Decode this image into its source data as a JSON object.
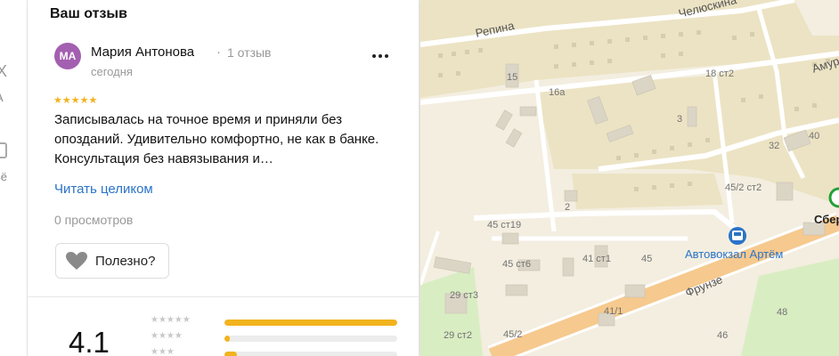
{
  "sidebar_fragment": {
    "glyph_top": "X",
    "glyph_mid": "А",
    "glyph_bottom": "ьё"
  },
  "review": {
    "section_title": "Ваш отзыв",
    "author": {
      "initials": "МА",
      "name": "Мария Антонова",
      "separator": "·",
      "review_count": "1 отзыв",
      "avatar_color": "#a35fb0"
    },
    "date": "сегодня",
    "stars": "★★★★★",
    "rating": 5,
    "text": "Записывалась на точное время и приняли без опозданий. Удивительно комфортно, не как в банке. Консультация без навязывания и…",
    "read_more_label": "Читать целиком",
    "views": "0 просмотров",
    "helpful_label": "Полезно?",
    "more_icon": "more-dots-icon"
  },
  "rating_summary": {
    "value": "4.1",
    "rows": [
      {
        "stars": "★★★★★",
        "share": 1.0
      },
      {
        "stars": "★★★★",
        "share": 0.03
      },
      {
        "stars": "★★★",
        "share": 0.07
      }
    ],
    "accent_color": "#f2b31d"
  },
  "map": {
    "streets": {
      "repina": "Репина",
      "chelyuskina": "Челюскина",
      "amur": "Амур",
      "frunze": "Фрунзе"
    },
    "buildings": {
      "b15": "15",
      "b16a": "16а",
      "b18st2": "18 ст2",
      "b3": "3",
      "b40": "40",
      "b32": "32",
      "b45st2": "45/2 ст2",
      "b2": "2",
      "b45st19": "45 ст19",
      "b41st1": "41 ст1",
      "b45st6": "45 ст6",
      "b45a": "45",
      "b29st3": "29 ст3",
      "b41_1": "41/1",
      "b29st2": "29 ст2",
      "b45_2": "45/2",
      "b46": "46",
      "b48": "48"
    },
    "pois": {
      "bus_station": "Автовокзал Артём",
      "bank": "Сбер"
    },
    "colors": {
      "background": "#f3eee0",
      "residential": "#ece3c4",
      "road": "#ffffff",
      "highway": "#f6c98e",
      "green": "#d9edc3",
      "poi_blue": "#2b73c8"
    }
  }
}
